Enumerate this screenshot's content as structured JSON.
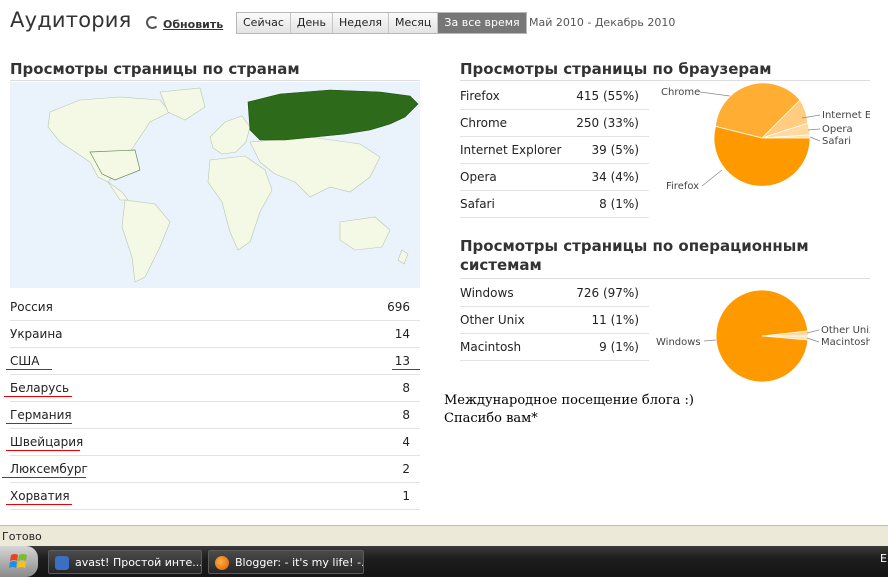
{
  "header": {
    "title": "Аудитория",
    "refresh_label": "Обновить",
    "tabs": [
      "Сейчас",
      "День",
      "Неделя",
      "Месяц",
      "За все время"
    ],
    "active_tab": "За все время",
    "date_range": "Май 2010 - Декабрь 2010"
  },
  "countries": {
    "heading": "Просмотры страницы по странам",
    "rows": [
      {
        "name": "Россия",
        "value": "696"
      },
      {
        "name": "Украина",
        "value": "14"
      },
      {
        "name": "США",
        "value": "13"
      },
      {
        "name": "Беларусь",
        "value": "8"
      },
      {
        "name": "Германия",
        "value": "8"
      },
      {
        "name": "Швейцария",
        "value": "4"
      },
      {
        "name": "Люксембург",
        "value": "2"
      },
      {
        "name": "Хорватия",
        "value": "1"
      }
    ]
  },
  "browsers": {
    "heading": "Просмотры страницы по браузерам",
    "rows": [
      {
        "name": "Firefox",
        "value": "415 (55%)"
      },
      {
        "name": "Chrome",
        "value": "250 (33%)"
      },
      {
        "name": "Internet Explorer",
        "value": "39 (5%)"
      },
      {
        "name": "Opera",
        "value": "34 (4%)"
      },
      {
        "name": "Safari",
        "value": "8 (1%)"
      }
    ],
    "pie_labels": [
      "Firefox",
      "Chrome",
      "Internet Ex",
      "Opera",
      "Safari"
    ]
  },
  "os": {
    "heading_line1": "Просмотры страницы по операционным",
    "heading_line2": "системам",
    "rows": [
      {
        "name": "Windows",
        "value": "726 (97%)"
      },
      {
        "name": "Other Unix",
        "value": "11 (1%)"
      },
      {
        "name": "Macintosh",
        "value": "9 (1%)"
      }
    ],
    "pie_labels": [
      "Windows",
      "Other Unix",
      "Macintosh"
    ]
  },
  "note": {
    "line1": "Международное посещение блога :)",
    "line2": "Спасибо вам*"
  },
  "status_bar": {
    "text": "Готово"
  },
  "taskbar": {
    "items": [
      {
        "label": "avast! Простой инте...",
        "icon": "avast-icon"
      },
      {
        "label": "Blogger: - it's my life! -...",
        "icon": "firefox-icon"
      }
    ],
    "tray_text": "E"
  },
  "colors": {
    "pie_dark": "#ff9900",
    "pie_mid": "#ffad33",
    "pie_light": "#ffcc80",
    "map_highlight": "#2d6a1a",
    "map_land": "#f4f9e6",
    "underline": "#e00000"
  }
}
